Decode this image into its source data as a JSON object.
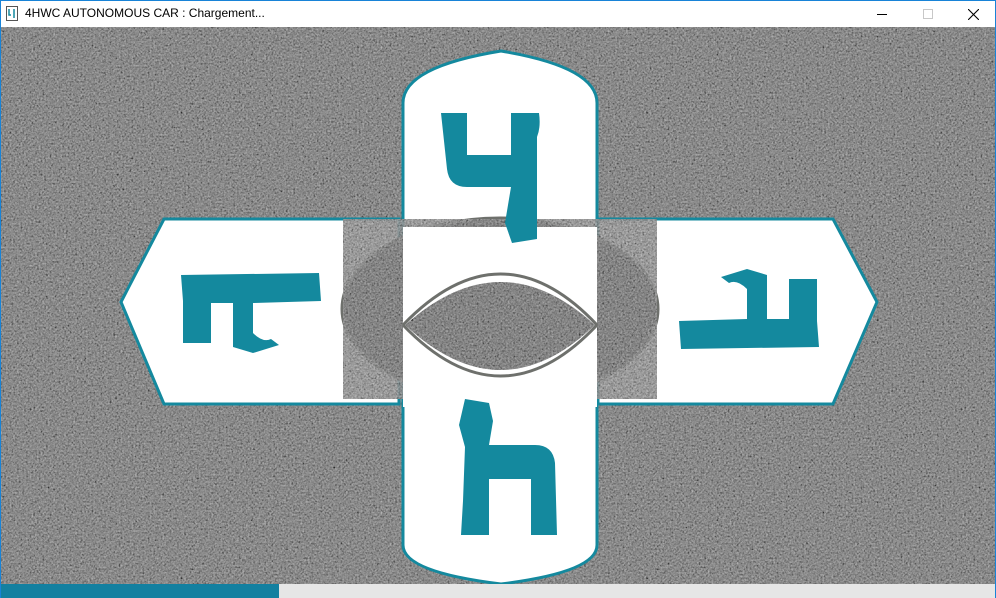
{
  "window": {
    "title": "4HWC AUTONOMOUS CAR : Chargement...",
    "icon": "app-logo-icon",
    "controls": [
      "minimize-icon",
      "maximize-icon",
      "close-icon"
    ]
  },
  "splash": {
    "background": "asphalt-texture",
    "logo": "4hwc-cross-logo",
    "logo_fill_color": "#ffffff",
    "logo_accent_color": "#14899e",
    "logo_outline_color": "#6e706c"
  },
  "progress": {
    "value_fraction": 0.28,
    "fill_color": "#1380a0",
    "track_color": "#e6e6e6"
  }
}
